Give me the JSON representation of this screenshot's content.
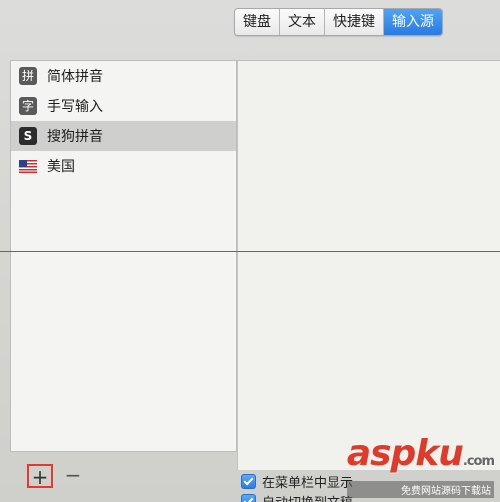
{
  "tabs": [
    {
      "label": "键盘",
      "active": false
    },
    {
      "label": "文本",
      "active": false
    },
    {
      "label": "快捷键",
      "active": false
    },
    {
      "label": "输入源",
      "active": true
    }
  ],
  "input_sources": [
    {
      "label": "简体拼音",
      "icon": "拼",
      "icon_name": "pinyin-icon",
      "selected": false
    },
    {
      "label": "手写输入",
      "icon": "字",
      "icon_name": "handwriting-icon",
      "selected": false
    },
    {
      "label": "搜狗拼音",
      "icon": "S",
      "icon_name": "sogou-icon",
      "selected": true
    },
    {
      "label": "美国",
      "icon": "",
      "icon_name": "us-flag-icon",
      "selected": false
    }
  ],
  "controls": {
    "add_label": "+",
    "remove_label": "−"
  },
  "options": [
    {
      "label": "在菜单栏中显示",
      "checked": true
    },
    {
      "label": "自动切换到文稿",
      "checked": true
    }
  ],
  "watermark": {
    "logo": "aspku",
    "tld": ".com",
    "subtitle": "免费网站源码下载站"
  },
  "colors": {
    "accent": "#2a7ae2",
    "guide_line": "#e4302f",
    "highlight_box": "#e5392d"
  }
}
